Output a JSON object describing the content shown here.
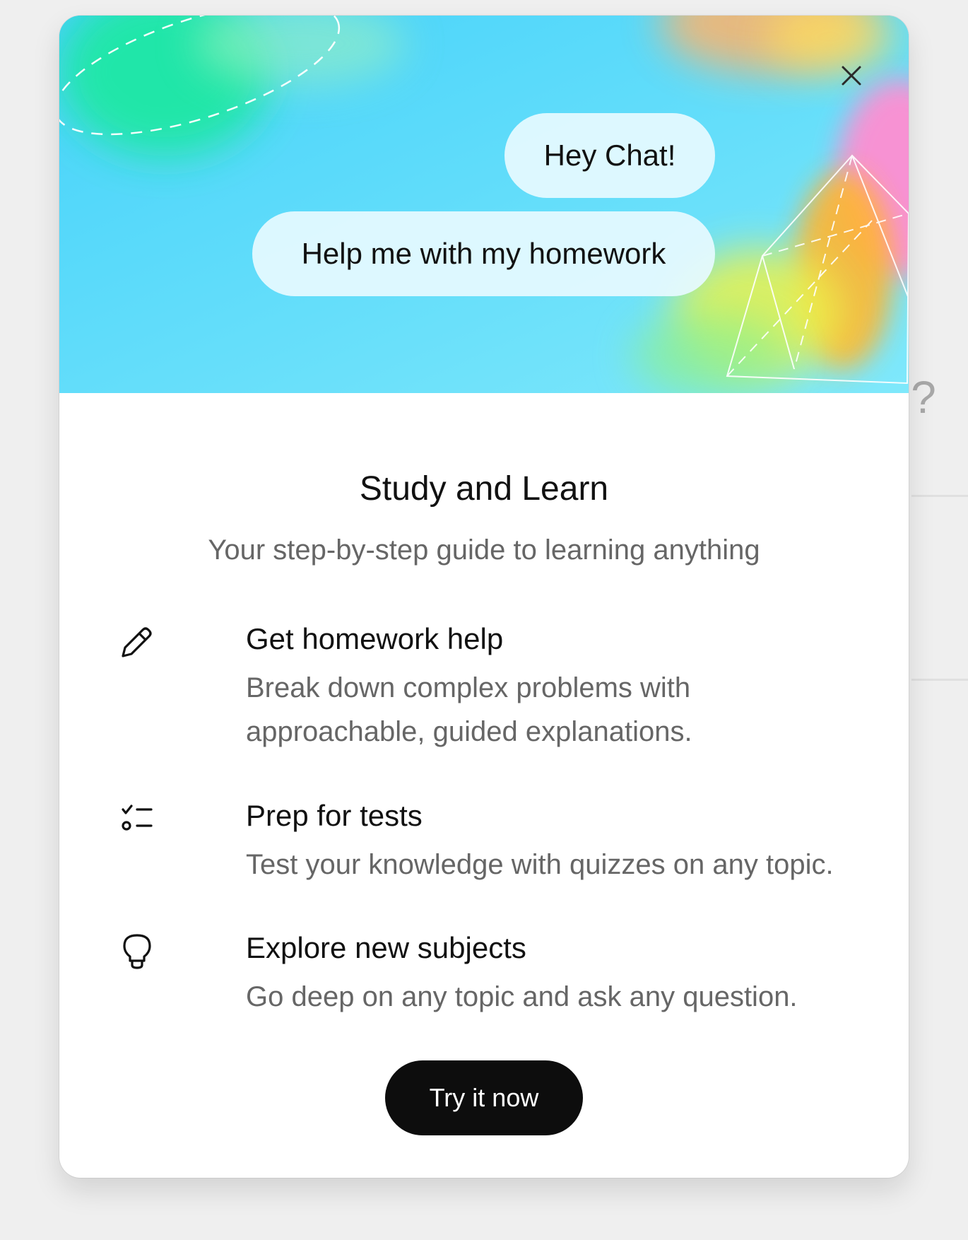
{
  "backdrop": {
    "partial_text": "l?"
  },
  "hero": {
    "bubbles": [
      "Hey Chat!",
      "Help me with my homework"
    ]
  },
  "modal": {
    "title": "Study and Learn",
    "subtitle": "Your step-by-step guide to learning anything",
    "features": [
      {
        "icon": "pencil-icon",
        "title": "Get homework help",
        "description": "Break down complex problems with approachable, guided explanations."
      },
      {
        "icon": "checklist-icon",
        "title": "Prep for tests",
        "description": "Test your knowledge with quizzes on any topic."
      },
      {
        "icon": "lightbulb-icon",
        "title": "Explore new subjects",
        "description": "Go deep on any topic and ask any question."
      }
    ],
    "cta_label": "Try it now",
    "close_icon": "close-icon"
  },
  "colors": {
    "hero_background": "#4fd7f8",
    "cta_background": "#0d0d0d",
    "page_background": "#efefef"
  }
}
